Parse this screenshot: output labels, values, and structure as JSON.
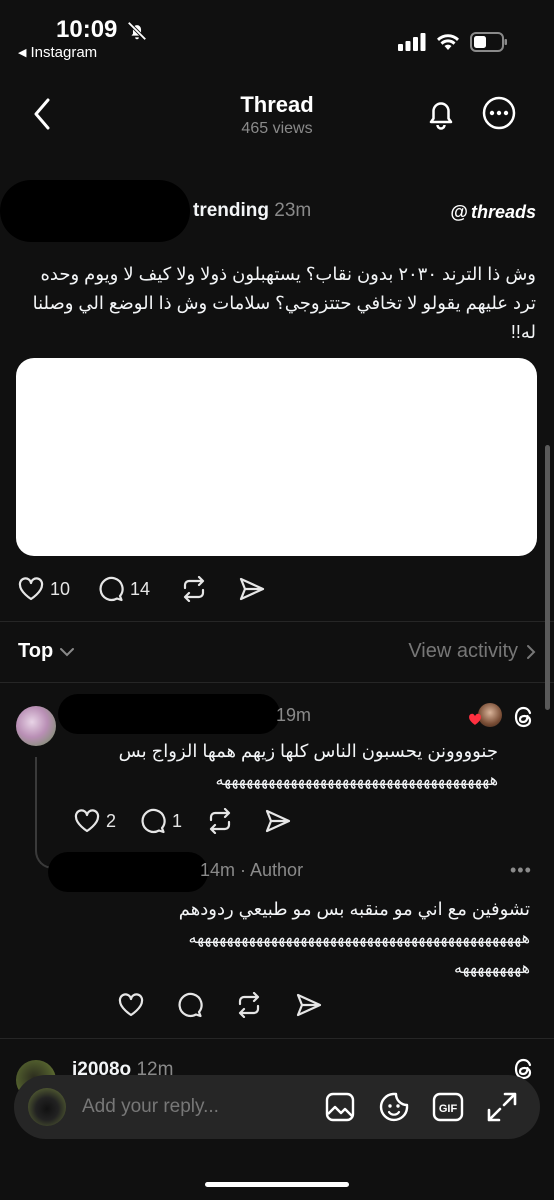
{
  "status": {
    "time": "10:09",
    "back_app": "Instagram"
  },
  "nav": {
    "title": "Thread",
    "views": "465 views"
  },
  "post": {
    "username": "trending",
    "time": "23m",
    "brand": "threads",
    "text": "وش ذا الترند ٢٠٣٠ بدون نقاب؟ يستهبلون ذولا ولا كيف لا ويوم وحده ترد عليهم يقولو لا تخافي حتتزوجي؟ سلامات وش ذا الوضع الي وصلنا له!!",
    "likes": "10",
    "comments": "14"
  },
  "sort": {
    "label": "Top",
    "view_activity": "View activity"
  },
  "replies": [
    {
      "time": "19m",
      "text_line1": "جنوووونن يحسبون الناس كلها زيهم همها الزواج بس",
      "text_line2": "هههههههههههههههههههههههههههههههههههههه",
      "likes": "2",
      "comments": "1"
    },
    {
      "time": "14m",
      "author_tag": "· Author",
      "more": "•••",
      "text_line1": "تشوفين مع اني مو منقبه بس مو طبيعي ردودهم",
      "text_line2": "هههههههههههههههههههههههههههههههههههههههههههههه",
      "text_line3": "هههههههههه"
    },
    {
      "username": "i2008o",
      "time": "12m"
    }
  ],
  "composer": {
    "placeholder": "Add your reply..."
  },
  "colors": {
    "background": "#101010",
    "text": "#f3f5f7",
    "muted": "#8a8a8a",
    "heart_red": "#ff3040"
  }
}
